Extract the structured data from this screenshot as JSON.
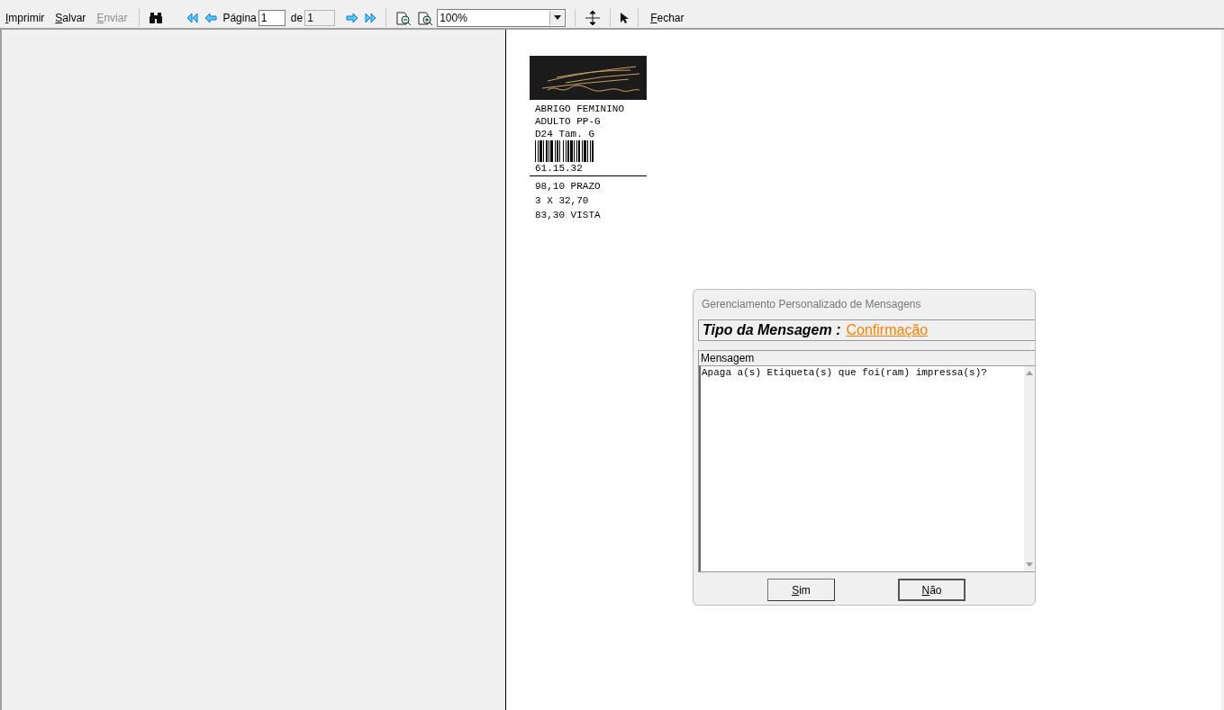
{
  "toolbar": {
    "menu_buttons": [
      {
        "label": "Imprimir",
        "disabled": false
      },
      {
        "label": "Salvar",
        "disabled": false
      },
      {
        "label": "Enviar",
        "disabled": true
      }
    ],
    "page_label": "Página",
    "page_value": "1",
    "of_label": "de",
    "total_value": "1",
    "zoom_value": "100%",
    "close_button": "Fechar"
  },
  "label": {
    "lines": [
      "ABRIGO FEMININO",
      "ADULTO PP-G",
      "D24 Tam. G"
    ],
    "code": "61.15.32",
    "price_lines": [
      "98,10 PRAZO",
      "3 X 32,70",
      "83,30 VISTA"
    ]
  },
  "dialog": {
    "title": "Gerenciamento Personalizado de Mensagens",
    "type_label": "Tipo da Mensagem :",
    "type_value": "Confirmação",
    "message_label": "Mensagem",
    "message": "Apaga a(s) Etiqueta(s) que foi(ram) impressa(s)?",
    "buttons": [
      {
        "label": "Sim",
        "selected": false
      },
      {
        "label": "Não",
        "selected": true
      }
    ]
  }
}
